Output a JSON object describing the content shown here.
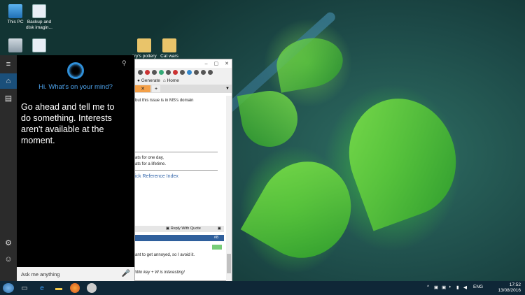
{
  "desktop": {
    "icons": [
      {
        "label": "This PC",
        "icon": "computer-icon"
      },
      {
        "label": "Backup and disk imagin...",
        "icon": "document-icon"
      },
      {
        "label": "",
        "icon": "recycle-bin-icon"
      },
      {
        "label": "",
        "icon": "document-icon"
      },
      {
        "label": "ary's pottery",
        "icon": "folder-icon"
      },
      {
        "label": "Cat wars",
        "icon": "folder-icon"
      }
    ]
  },
  "cortana": {
    "greeting": "Hi. What's on your mind?",
    "message": "Go ahead and tell me to do something. Interests aren't available at the moment.",
    "search_placeholder": "Ask me anything",
    "accent": "#2f8fd8"
  },
  "browser": {
    "bookmarks": [
      "Generate",
      "Home"
    ],
    "new_tab": "+",
    "lines": {
      "domain": "but this issue is in MS's domain",
      "quote1": "ats for one day,",
      "quote2": "ats for a lifetime.",
      "link": "ick Reference Index",
      "reply": "Reply With Quote",
      "post_num": "#8",
      "annoyed": "ant to get annoyed, so I avoid it.",
      "winkey": "Win key + W is interesting!"
    }
  },
  "taskbar": {
    "language": "ENG",
    "time": "17:52",
    "date": "13/08/2016"
  }
}
